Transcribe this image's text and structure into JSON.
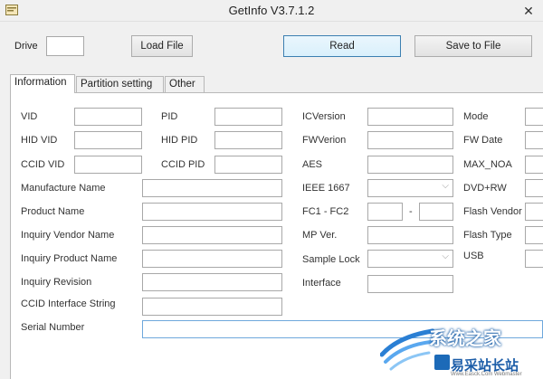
{
  "window": {
    "title": "GetInfo V3.7.1.2",
    "close_glyph": "✕"
  },
  "toolbar": {
    "drive_label": "Drive",
    "drive_value": "",
    "load_file": "Load File",
    "read": "Read",
    "save_to_file": "Save to File"
  },
  "tabs": {
    "information": "Information",
    "partition": "Partition setting",
    "other": "Other"
  },
  "info": {
    "vid": "VID",
    "pid": "PID",
    "icversion": "ICVersion",
    "mode": "Mode",
    "hid_vid": "HID VID",
    "hid_pid": "HID PID",
    "fwverion": "FWVerion",
    "fw_date": "FW Date",
    "ccid_vid": "CCID VID",
    "ccid_pid": "CCID PID",
    "aes": "AES",
    "max_noa": "MAX_NOA",
    "manufacture_name": "Manufacture Name",
    "ieee1667": "IEEE 1667",
    "dvd_rw": "DVD+RW",
    "product_name": "Product Name",
    "fc1_fc2": "FC1 - FC2",
    "fc_dash": "-",
    "flash_vendor": "Flash Vendor",
    "inquiry_vendor_name": "Inquiry Vendor Name",
    "mp_ver": "MP Ver.",
    "flash_type": "Flash Type",
    "inquiry_product_name": "Inquiry Product Name",
    "sample_lock": "Sample Lock",
    "usb": "USB",
    "inquiry_revision": "Inquiry Revision",
    "interface": "Interface",
    "ccid_interface_string": "CCID Interface String",
    "serial_number": "Serial Number"
  },
  "watermark": {
    "top": "系统之家",
    "bottom": "易采站长站",
    "url": "Www.Easck.Com Webmaster"
  },
  "colors": {
    "accent": "#3c7fb1",
    "watermark_blue": "#1c5da8"
  }
}
